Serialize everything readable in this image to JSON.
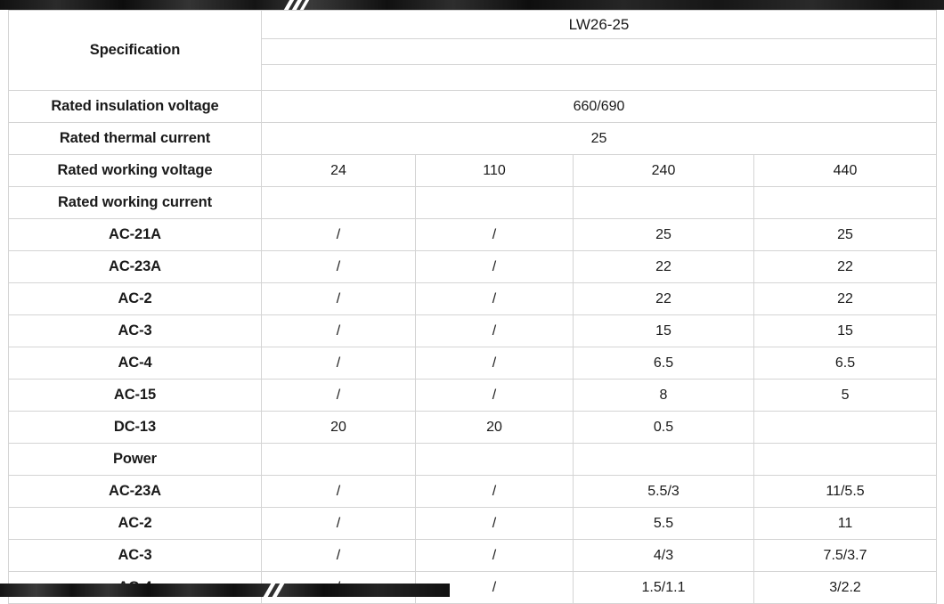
{
  "table": {
    "label_column_header": "Specification",
    "model": "LW26-25",
    "columns": [
      "24",
      "110",
      "240",
      "440"
    ],
    "rows": [
      {
        "label": "Specification",
        "type": "header-model",
        "value": "LW26-25"
      },
      {
        "label": "",
        "type": "blank-a",
        "value": ""
      },
      {
        "label": "",
        "type": "blank-b",
        "value": ""
      },
      {
        "label": "Rated insulation voltage",
        "type": "span",
        "value": "660/690"
      },
      {
        "label": "Rated thermal current",
        "type": "span",
        "value": "25"
      },
      {
        "label": "Rated working voltage",
        "type": "data",
        "cells": [
          "24",
          "110",
          "240",
          "440"
        ]
      },
      {
        "label": "Rated working current",
        "type": "data",
        "cells": [
          "",
          "",
          "",
          ""
        ]
      },
      {
        "label": "AC-21A",
        "type": "data",
        "cells": [
          "/",
          "/",
          "25",
          "25"
        ]
      },
      {
        "label": "AC-23A",
        "type": "data",
        "cells": [
          "/",
          "/",
          "22",
          "22"
        ]
      },
      {
        "label": "AC-2",
        "type": "data",
        "cells": [
          "/",
          "/",
          "22",
          "22"
        ]
      },
      {
        "label": "AC-3",
        "type": "data",
        "cells": [
          "/",
          "/",
          "15",
          "15"
        ]
      },
      {
        "label": "AC-4",
        "type": "data",
        "cells": [
          "/",
          "/",
          "6.5",
          "6.5"
        ]
      },
      {
        "label": "AC-15",
        "type": "data",
        "cells": [
          "/",
          "/",
          "8",
          "5"
        ]
      },
      {
        "label": "DC-13",
        "type": "data",
        "cells": [
          "20",
          "20",
          "0.5",
          ""
        ]
      },
      {
        "label": "Power",
        "type": "data",
        "cells": [
          "",
          "",
          "",
          ""
        ]
      },
      {
        "label": "AC-23A",
        "type": "data",
        "cells": [
          "/",
          "/",
          "5.5/3",
          "11/5.5"
        ]
      },
      {
        "label": "AC-2",
        "type": "data",
        "cells": [
          "/",
          "/",
          "5.5",
          "11"
        ]
      },
      {
        "label": "AC-3",
        "type": "data",
        "cells": [
          "/",
          "/",
          "4/3",
          "7.5/3.7"
        ]
      },
      {
        "label": "AC-4",
        "type": "data",
        "cells": [
          "/",
          "/",
          "1.5/1.1",
          "3/2.2"
        ]
      }
    ]
  },
  "colors": {
    "border": "#d4d4d4",
    "text": "#1a1a1a",
    "band": "#151515",
    "page_background": "#ffffff"
  }
}
